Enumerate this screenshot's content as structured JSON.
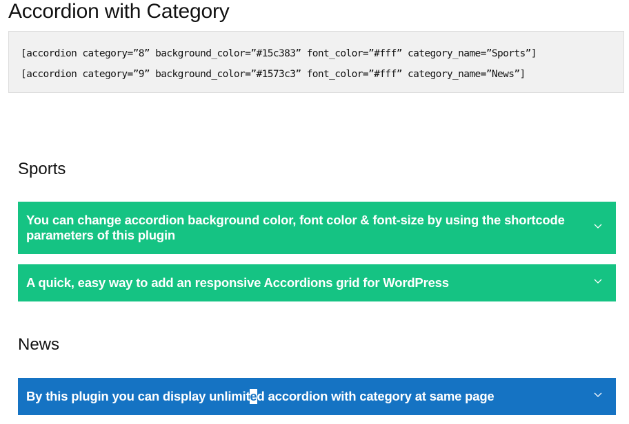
{
  "page": {
    "title": "Accordion with Category"
  },
  "code_block": {
    "lines": [
      "[accordion category=”8” background_color=”#15c383” font_color=”#fff” category_name=”Sports”]",
      "[accordion category=”9” background_color=”#1573c3” font_color=”#fff” category_name=”News”]"
    ]
  },
  "colors": {
    "sports_bg": "#15c383",
    "news_bg": "#1573c3",
    "font": "#ffffff"
  },
  "sections": [
    {
      "heading": "Sports",
      "items": [
        {
          "title": "You can change accordion background color, font color & font-size by using the shortcode parameters of this plugin",
          "icon": "chevron-down-icon"
        },
        {
          "title": "A quick, easy way to add an responsive Accordions grid for WordPress",
          "icon": "chevron-down-icon"
        }
      ]
    },
    {
      "heading": "News",
      "items": [
        {
          "title_before_cursor": "By this plugin you can display unlimit",
          "title_cursor_char": "e",
          "title_after_cursor": "d accordion with category at same page",
          "icon": "chevron-down-icon"
        }
      ]
    }
  ]
}
